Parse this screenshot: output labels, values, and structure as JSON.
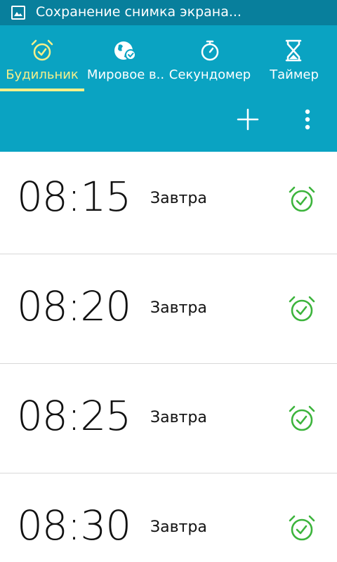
{
  "statusbar": {
    "notification_text": "Сохранение снимка экрана..."
  },
  "tabs": [
    {
      "label": "Будильник",
      "icon": "alarm-clock-icon",
      "active": true
    },
    {
      "label": "Мировое в..",
      "icon": "world-clock-icon",
      "active": false
    },
    {
      "label": "Секундомер",
      "icon": "stopwatch-icon",
      "active": false
    },
    {
      "label": "Таймер",
      "icon": "hourglass-icon",
      "active": false
    }
  ],
  "actions": {
    "add_icon": "plus-icon",
    "more_icon": "more-vert-icon"
  },
  "alarms": [
    {
      "time": "08:15",
      "day": "Завтра",
      "enabled": true
    },
    {
      "time": "08:20",
      "day": "Завтра",
      "enabled": true
    },
    {
      "time": "08:25",
      "day": "Завтра",
      "enabled": true
    },
    {
      "time": "08:30",
      "day": "Завтра",
      "enabled": true
    }
  ],
  "colors": {
    "statusbar": "#087f9c",
    "appbar": "#0aa3c2",
    "active_tab": "#f6f08a",
    "alarm_on": "#3cb43c"
  }
}
